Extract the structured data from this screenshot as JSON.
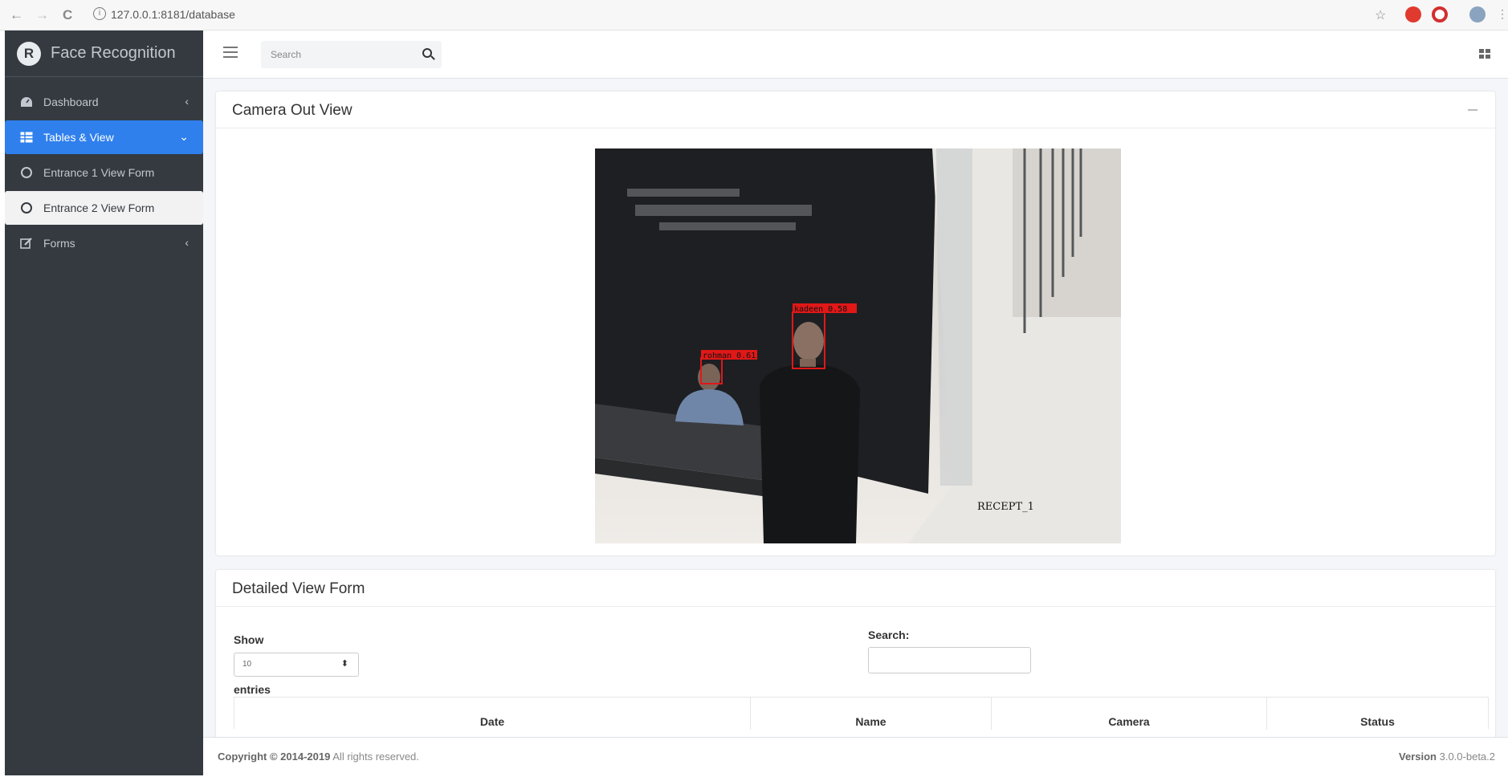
{
  "browser": {
    "url": "127.0.0.1:8181/database",
    "back": "←",
    "forward": "→",
    "reload": "C",
    "info": "i",
    "star": "☆"
  },
  "sidebar": {
    "brand": "Face Recognition",
    "brand_logo": "R",
    "items": [
      {
        "label": "Dashboard",
        "icon": "dashboard-icon",
        "caret": "‹"
      },
      {
        "label": "Tables & View",
        "icon": "table-icon",
        "caret": "⌄"
      },
      {
        "label": "Entrance 1 View Form",
        "icon": "circle-icon"
      },
      {
        "label": "Entrance 2 View Form",
        "icon": "circle-icon"
      },
      {
        "label": "Forms",
        "icon": "edit-icon",
        "caret": "‹"
      }
    ]
  },
  "topbar": {
    "search_placeholder": "Search"
  },
  "camera_card": {
    "title": "Camera Out View",
    "detections": [
      {
        "label": "kadeen_0.58"
      },
      {
        "label": "rohman_0.61"
      }
    ],
    "camera_label": "RECEPT_1"
  },
  "table_card": {
    "title": "Detailed View Form",
    "show_label": "Show",
    "entries_value": "10",
    "entries_label": "entries",
    "search_label": "Search:",
    "columns": [
      "Date",
      "Name",
      "Camera",
      "Status"
    ]
  },
  "footer": {
    "copyright_bold": "Copyright © 2014-2019",
    "copyright_rest": " All rights reserved.",
    "version_bold": "Version",
    "version_value": " 3.0.0-beta.2"
  },
  "colors": {
    "sidebar_bg": "#343a40",
    "active_bg": "#2f80ed",
    "detection_box": "#e01818"
  }
}
